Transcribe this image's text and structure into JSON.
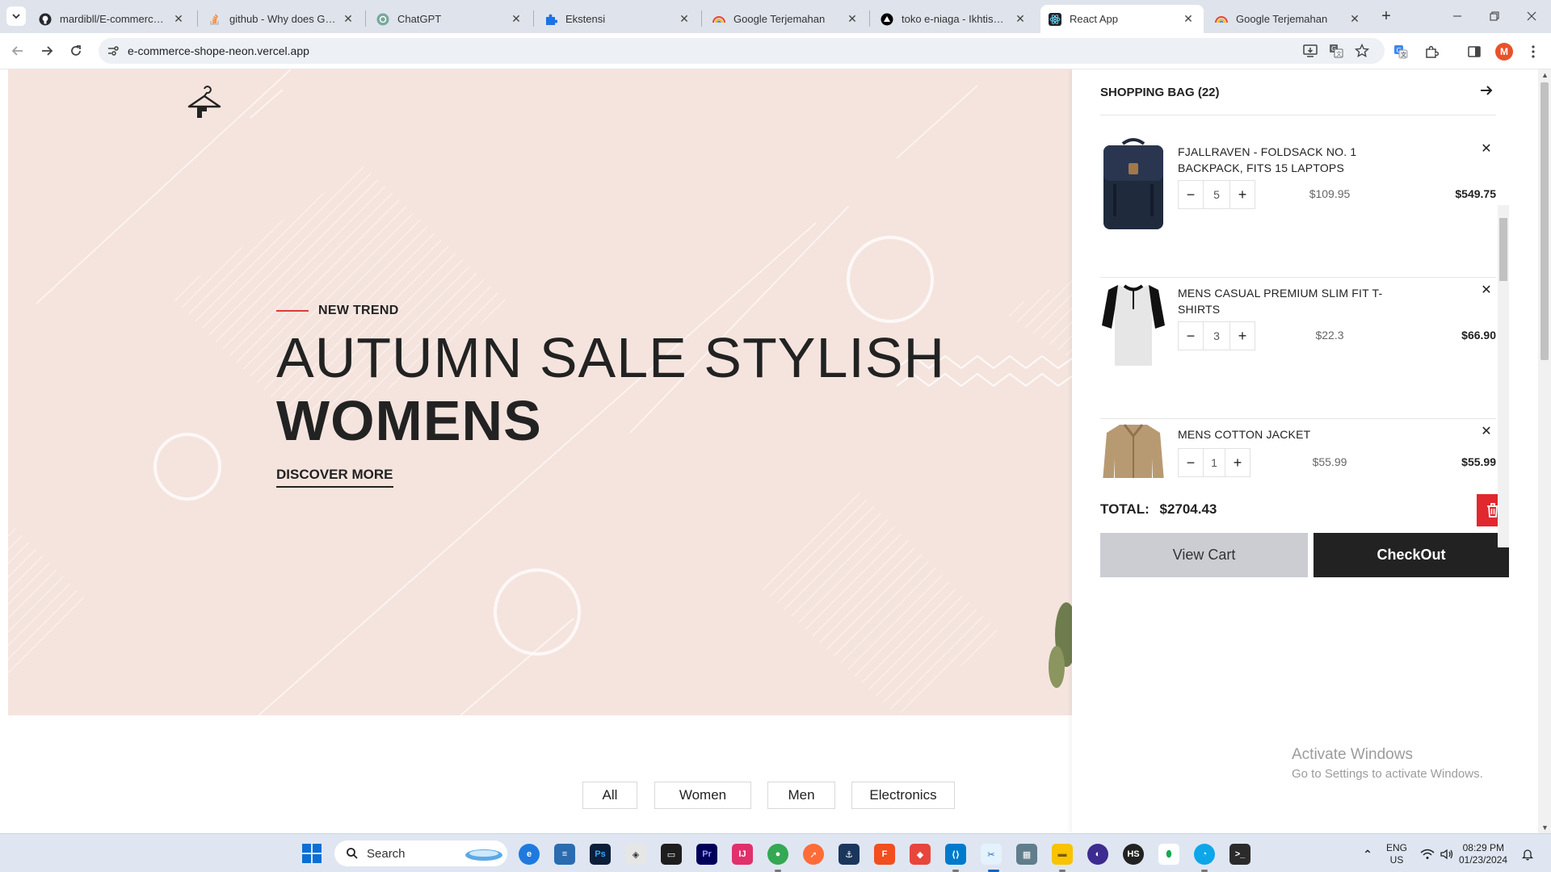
{
  "browser": {
    "tabs": [
      {
        "title": "mardibll/E-commerce-Sh",
        "icon": "github-icon"
      },
      {
        "title": "github - Why does Git tel",
        "icon": "stackoverflow-icon"
      },
      {
        "title": "ChatGPT",
        "icon": "chatgpt-icon"
      },
      {
        "title": "Ekstensi",
        "icon": "puzzle-icon"
      },
      {
        "title": "Google Terjemahan",
        "icon": "google-translate-icon"
      },
      {
        "title": "toko e-niaga - Ikhtisar - V",
        "icon": "vercel-icon"
      },
      {
        "title": "React App",
        "icon": "react-icon",
        "active": true
      },
      {
        "title": "Google Terjemahan",
        "icon": "google-translate-icon"
      }
    ],
    "url": "e-commerce-shope-neon.vercel.app",
    "profile_initial": "M"
  },
  "hero": {
    "kicker": "NEW TREND",
    "title_line1": "AUTUMN SALE STYLISH",
    "title_line2": "WOMENS",
    "cta": "DISCOVER MORE"
  },
  "filters": [
    "All",
    "Women",
    "Men",
    "Electronics"
  ],
  "cart": {
    "title": "SHOPPING BAG (22)",
    "items": [
      {
        "name": "FJALLRAVEN - FOLDSACK NO. 1 BACKPACK, FITS 15 LAPTOPS",
        "qty": "5",
        "price": "$109.95",
        "total": "$549.75"
      },
      {
        "name": "MENS CASUAL PREMIUM SLIM FIT T-SHIRTS",
        "qty": "3",
        "price": "$22.3",
        "total": "$66.90"
      },
      {
        "name": "MENS COTTON JACKET",
        "qty": "1",
        "price": "$55.99",
        "total": "$55.99"
      }
    ],
    "total_label": "TOTAL:",
    "total_value": "$2704.43",
    "view_cart": "View Cart",
    "checkout": "CheckOut"
  },
  "watermark": {
    "line1": "Activate Windows",
    "line2": "Go to Settings to activate Windows."
  },
  "taskbar": {
    "search_label": "Search",
    "lang_line1": "ENG",
    "lang_line2": "US",
    "time": "08:29 PM",
    "date": "01/23/2024"
  },
  "colors": {
    "hero_bg": "#f5e4de",
    "accent_red": "#e0282e",
    "checkout_bg": "#222222",
    "view_cart_bg": "#cbcdd3"
  }
}
